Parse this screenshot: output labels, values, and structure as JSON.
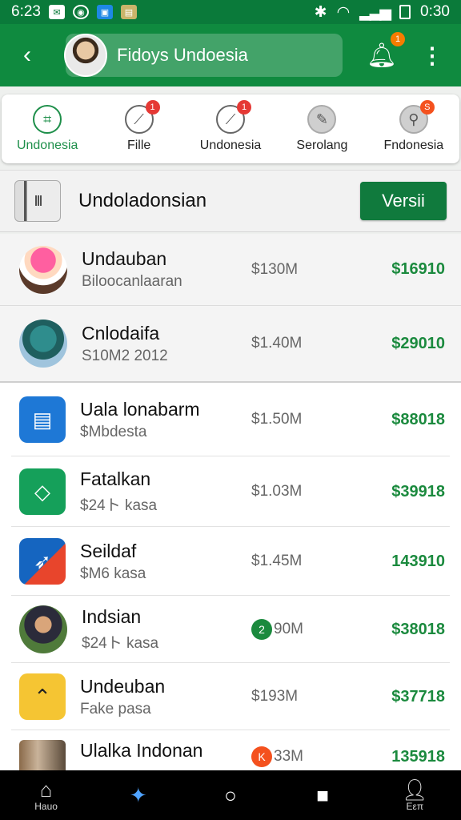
{
  "status_bar": {
    "time": "6:23",
    "clock": "0:30"
  },
  "app_bar": {
    "title": "Fidoys Undoesia",
    "bell_badge": "1"
  },
  "categories": [
    {
      "label": "Undonesia",
      "icon": "target-icon",
      "badge": ""
    },
    {
      "label": "Fille",
      "icon": "slash-icon",
      "badge": "1"
    },
    {
      "label": "Undonesia",
      "icon": "slash-icon",
      "badge": "1"
    },
    {
      "label": "Serolang",
      "icon": "pencil-icon",
      "badge": ""
    },
    {
      "label": "Fndonesia",
      "icon": "search-icon",
      "badge": "S"
    }
  ],
  "header": {
    "title": "Undoladonsian",
    "button": "Versii",
    "phone_glyph": "III"
  },
  "items": [
    {
      "name": "Undauban",
      "sub": "Biloocanlaaran",
      "price": "$130M",
      "value": "$16910"
    },
    {
      "name": "Cnlodaifa",
      "sub": "S10M2 2012",
      "price": "$1.40M",
      "value": "$29010"
    },
    {
      "name": "Uala lonabarm",
      "sub": "$Mbdesta",
      "price": "$1.50M",
      "value": "$88018"
    },
    {
      "name": "Fatalkan",
      "sub": "$24ト kasa",
      "price": "$1.03M",
      "value": "$39918"
    },
    {
      "name": "Seildaf",
      "sub": "$M6 kasa",
      "price": "$1.45M",
      "value": "143910"
    },
    {
      "name": "Indsian",
      "sub": "$24ト kasa",
      "price": "90M",
      "price_icon": "2",
      "value": "$38018"
    },
    {
      "name": "Undeuban",
      "sub": "Fake pasa",
      "price": "$193M",
      "value": "$37718"
    },
    {
      "name": "Ulalka Indonan",
      "sub": "",
      "price": "33M",
      "price_icon": "K",
      "value": "135918"
    }
  ],
  "nav": {
    "home": "Hauo",
    "last": "Eεπ"
  },
  "colors": {
    "brand": "#0f8a3f",
    "value_green": "#1b8a3e",
    "button": "#107a3d"
  }
}
